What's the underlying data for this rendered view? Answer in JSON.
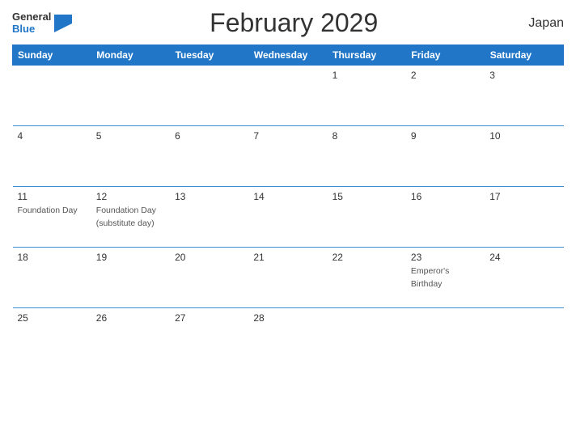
{
  "header": {
    "logo_general": "General",
    "logo_blue": "Blue",
    "title": "February 2029",
    "country": "Japan"
  },
  "weekdays": [
    "Sunday",
    "Monday",
    "Tuesday",
    "Wednesday",
    "Thursday",
    "Friday",
    "Saturday"
  ],
  "weeks": [
    [
      {
        "num": "",
        "event": ""
      },
      {
        "num": "",
        "event": ""
      },
      {
        "num": "",
        "event": ""
      },
      {
        "num": "",
        "event": ""
      },
      {
        "num": "1",
        "event": ""
      },
      {
        "num": "2",
        "event": ""
      },
      {
        "num": "3",
        "event": ""
      }
    ],
    [
      {
        "num": "4",
        "event": ""
      },
      {
        "num": "5",
        "event": ""
      },
      {
        "num": "6",
        "event": ""
      },
      {
        "num": "7",
        "event": ""
      },
      {
        "num": "8",
        "event": ""
      },
      {
        "num": "9",
        "event": ""
      },
      {
        "num": "10",
        "event": ""
      }
    ],
    [
      {
        "num": "11",
        "event": "Foundation Day"
      },
      {
        "num": "12",
        "event": "Foundation Day (substitute day)"
      },
      {
        "num": "13",
        "event": ""
      },
      {
        "num": "14",
        "event": ""
      },
      {
        "num": "15",
        "event": ""
      },
      {
        "num": "16",
        "event": ""
      },
      {
        "num": "17",
        "event": ""
      }
    ],
    [
      {
        "num": "18",
        "event": ""
      },
      {
        "num": "19",
        "event": ""
      },
      {
        "num": "20",
        "event": ""
      },
      {
        "num": "21",
        "event": ""
      },
      {
        "num": "22",
        "event": ""
      },
      {
        "num": "23",
        "event": "Emperor's Birthday"
      },
      {
        "num": "24",
        "event": ""
      }
    ],
    [
      {
        "num": "25",
        "event": ""
      },
      {
        "num": "26",
        "event": ""
      },
      {
        "num": "27",
        "event": ""
      },
      {
        "num": "28",
        "event": ""
      },
      {
        "num": "",
        "event": ""
      },
      {
        "num": "",
        "event": ""
      },
      {
        "num": "",
        "event": ""
      }
    ]
  ]
}
